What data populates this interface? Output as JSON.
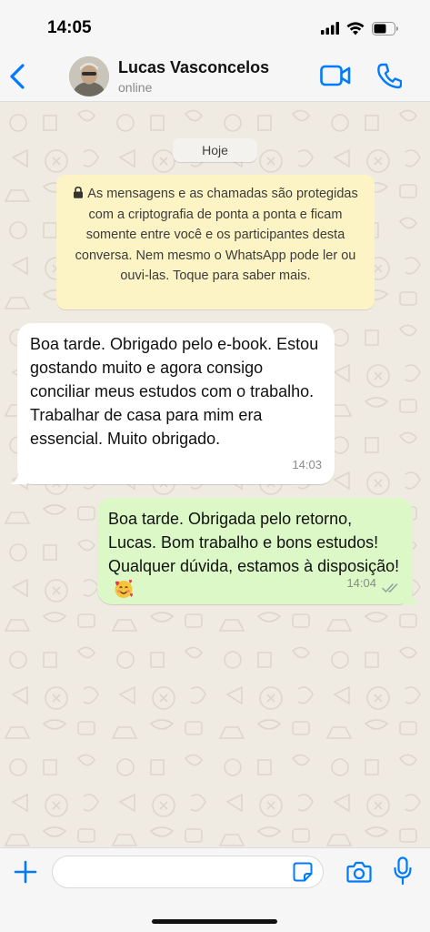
{
  "status_bar": {
    "time": "14:05"
  },
  "header": {
    "contact_name": "Lucas Vasconcelos",
    "contact_status": "online"
  },
  "chat": {
    "date_label": "Hoje",
    "encryption_notice": "As mensagens e as chamadas são protegidas com a criptografia de ponta a ponta e ficam somente entre você e os participantes desta conversa. Nem mesmo o WhatsApp pode ler ou ouvi-las. Toque para saber mais.",
    "messages": [
      {
        "direction": "incoming",
        "text": "Boa tarde. Obrigado pelo e-book. Estou gostando muito e agora consigo conciliar meus estudos com o trabalho. Trabalhar de casa para mim era essencial. Muito obrigado.",
        "time": "14:03"
      },
      {
        "direction": "outgoing",
        "text": "Boa tarde. Obrigada pelo retorno, Lucas. Bom trabalho e bons estudos! Qualquer dúvida, estamos à disposição!",
        "emoji": "smiling-face-with-hearts",
        "time": "14:04",
        "status": "read"
      }
    ]
  },
  "composer": {
    "value": "",
    "placeholder": ""
  },
  "colors": {
    "accent": "#007aff",
    "incoming_bubble": "#ffffff",
    "outgoing_bubble": "#dbf8c6",
    "notice_bg": "#fdf4c5",
    "chat_bg": "#efeae2"
  },
  "icons": [
    "cellular-signal-icon",
    "wifi-icon",
    "battery-icon",
    "back-chevron-icon",
    "video-call-icon",
    "phone-icon",
    "lock-icon",
    "double-check-icon",
    "plus-icon",
    "sticker-icon",
    "camera-icon",
    "microphone-icon"
  ]
}
